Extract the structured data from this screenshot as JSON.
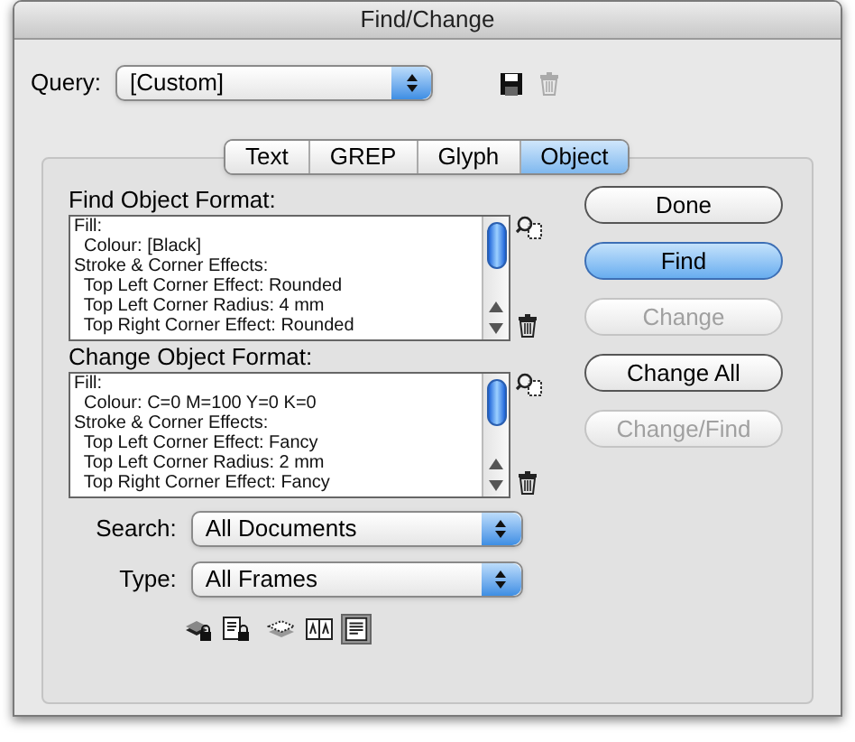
{
  "window": {
    "title": "Find/Change"
  },
  "query": {
    "label": "Query:",
    "value": "[Custom]"
  },
  "tabs": [
    {
      "label": "Text",
      "selected": false
    },
    {
      "label": "GREP",
      "selected": false
    },
    {
      "label": "Glyph",
      "selected": false
    },
    {
      "label": "Object",
      "selected": true
    }
  ],
  "find_format": {
    "label": "Find Object Format:",
    "lines": [
      "Fill:",
      "  Colour: [Black]",
      "Stroke & Corner Effects:",
      "  Top Left Corner Effect: Rounded",
      "  Top Left Corner Radius: 4 mm",
      "  Top Right Corner Effect: Rounded"
    ]
  },
  "change_format": {
    "label": "Change Object Format:",
    "lines": [
      "Fill:",
      "  Colour: C=0 M=100 Y=0 K=0",
      "Stroke & Corner Effects:",
      "  Top Left Corner Effect: Fancy",
      "  Top Left Corner Radius: 2 mm",
      "  Top Right Corner Effect: Fancy"
    ]
  },
  "search": {
    "label": "Search:",
    "value": "All Documents"
  },
  "type": {
    "label": "Type:",
    "value": "All Frames"
  },
  "options": [
    {
      "on": false
    },
    {
      "on": false
    },
    {
      "on": false
    },
    {
      "on": false
    },
    {
      "on": true
    }
  ],
  "buttons": [
    {
      "label": "Done",
      "disabled": false,
      "default": false
    },
    {
      "label": "Find",
      "disabled": false,
      "default": true
    },
    {
      "label": "Change",
      "disabled": true,
      "default": false
    },
    {
      "label": "Change All",
      "disabled": false,
      "default": false
    },
    {
      "label": "Change/Find",
      "disabled": true,
      "default": false
    }
  ]
}
